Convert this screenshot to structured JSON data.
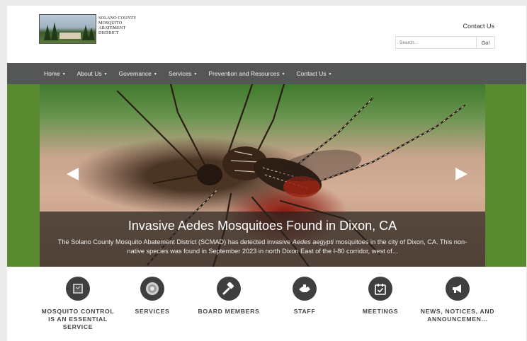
{
  "header": {
    "logo_lines": [
      "SOLANO COUNTY",
      "MOSQUITO",
      "ABATEMENT",
      "DISTRICT"
    ],
    "contact_link": "Contact Us",
    "search_placeholder": "Search...",
    "search_button": "Go!"
  },
  "nav": {
    "items": [
      "Home",
      "About Us",
      "Governance",
      "Services",
      "Prevention and Resources",
      "Contact Us"
    ]
  },
  "slider": {
    "title": "Invasive Aedes Mosquitoes Found in Dixon, CA",
    "body_before": "The Solano County Mosquito Abatement District (SCMAD) has detected invasive ",
    "body_italic": "Aedes aegypti",
    "body_after": " mosquitoes in the city of Dixon, CA. This non-native species was found in September 2023 in north Dixon East of the I-80 corridor, west of..."
  },
  "quick_links": [
    {
      "label": "MOSQUITO CONTROL IS AN ESSENTIAL SERVICE",
      "icon": "mosquito-image-icon"
    },
    {
      "label": "SERVICES",
      "icon": "services-image-icon"
    },
    {
      "label": "BOARD MEMBERS",
      "icon": "gavel-icon"
    },
    {
      "label": "STAFF",
      "icon": "handshake-icon"
    },
    {
      "label": "MEETINGS",
      "icon": "calendar-check-icon"
    },
    {
      "label": "NEWS, NOTICES, AND ANNOUNCEMEN...",
      "icon": "megaphone-icon"
    }
  ],
  "colors": {
    "nav_bg": "#555656",
    "hero_side_green": "#5a8a30",
    "icon_circle": "#3e3f41"
  }
}
